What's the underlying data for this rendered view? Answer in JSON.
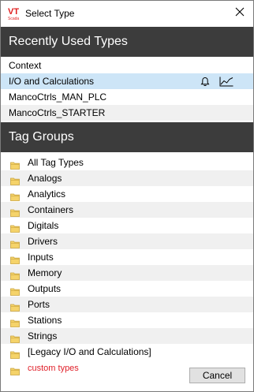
{
  "window": {
    "title": "Select Type",
    "logo_text": "VT",
    "logo_subtext": "Scada"
  },
  "recent": {
    "header": "Recently Used Types",
    "items": [
      {
        "label": "Context"
      },
      {
        "label": "I/O and Calculations",
        "selected": true,
        "icons": [
          "bell-icon",
          "trend-chart-icon"
        ]
      },
      {
        "label": "MancoCtrls_MAN_PLC"
      },
      {
        "label": "MancoCtrls_STARTER"
      }
    ]
  },
  "groups": {
    "header": "Tag Groups",
    "items": [
      {
        "label": "All Tag Types"
      },
      {
        "label": "Analogs"
      },
      {
        "label": "Analytics"
      },
      {
        "label": "Containers"
      },
      {
        "label": "Digitals"
      },
      {
        "label": "Drivers"
      },
      {
        "label": "Inputs"
      },
      {
        "label": "Memory"
      },
      {
        "label": "Outputs"
      },
      {
        "label": "Ports"
      },
      {
        "label": "Stations"
      },
      {
        "label": "Strings"
      },
      {
        "label": "[Legacy I/O and Calculations]"
      },
      {
        "label": "custom types"
      }
    ]
  },
  "footer": {
    "cancel_label": "Cancel"
  },
  "colors": {
    "header_bg": "#3c3c3c",
    "selected_row": "#cde5f7",
    "alt_row": "#f0f0f0",
    "folder": "#f5d36a",
    "custom_text": "#e0202a",
    "logo_red": "#e02020"
  }
}
